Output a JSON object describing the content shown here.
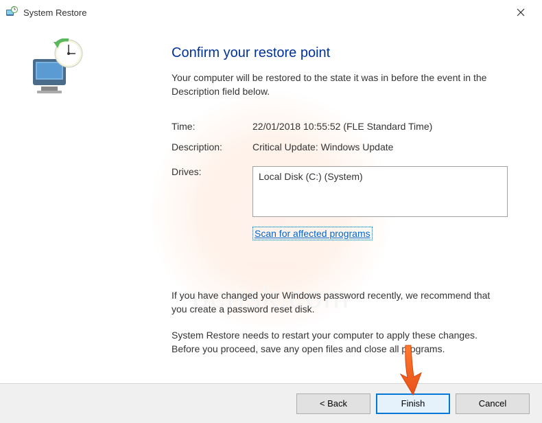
{
  "titlebar": {
    "title": "System Restore"
  },
  "main": {
    "heading": "Confirm your restore point",
    "subtext": "Your computer will be restored to the state it was in before the event in the Description field below.",
    "time_label": "Time:",
    "time_value": "22/01/2018 10:55:52 (FLE Standard Time)",
    "description_label": "Description:",
    "description_value": "Critical Update: Windows Update",
    "drives_label": "Drives:",
    "drives_value": "Local Disk (C:) (System)",
    "scan_link": "Scan for affected programs",
    "note_password": "If you have changed your Windows password recently, we recommend that you create a password reset disk.",
    "note_restart": "System Restore needs to restart your computer to apply these changes. Before you proceed, save any open files and close all programs."
  },
  "footer": {
    "back": "< Back",
    "finish": "Finish",
    "cancel": "Cancel"
  },
  "watermark": {
    "text": "pcrisk.com"
  }
}
